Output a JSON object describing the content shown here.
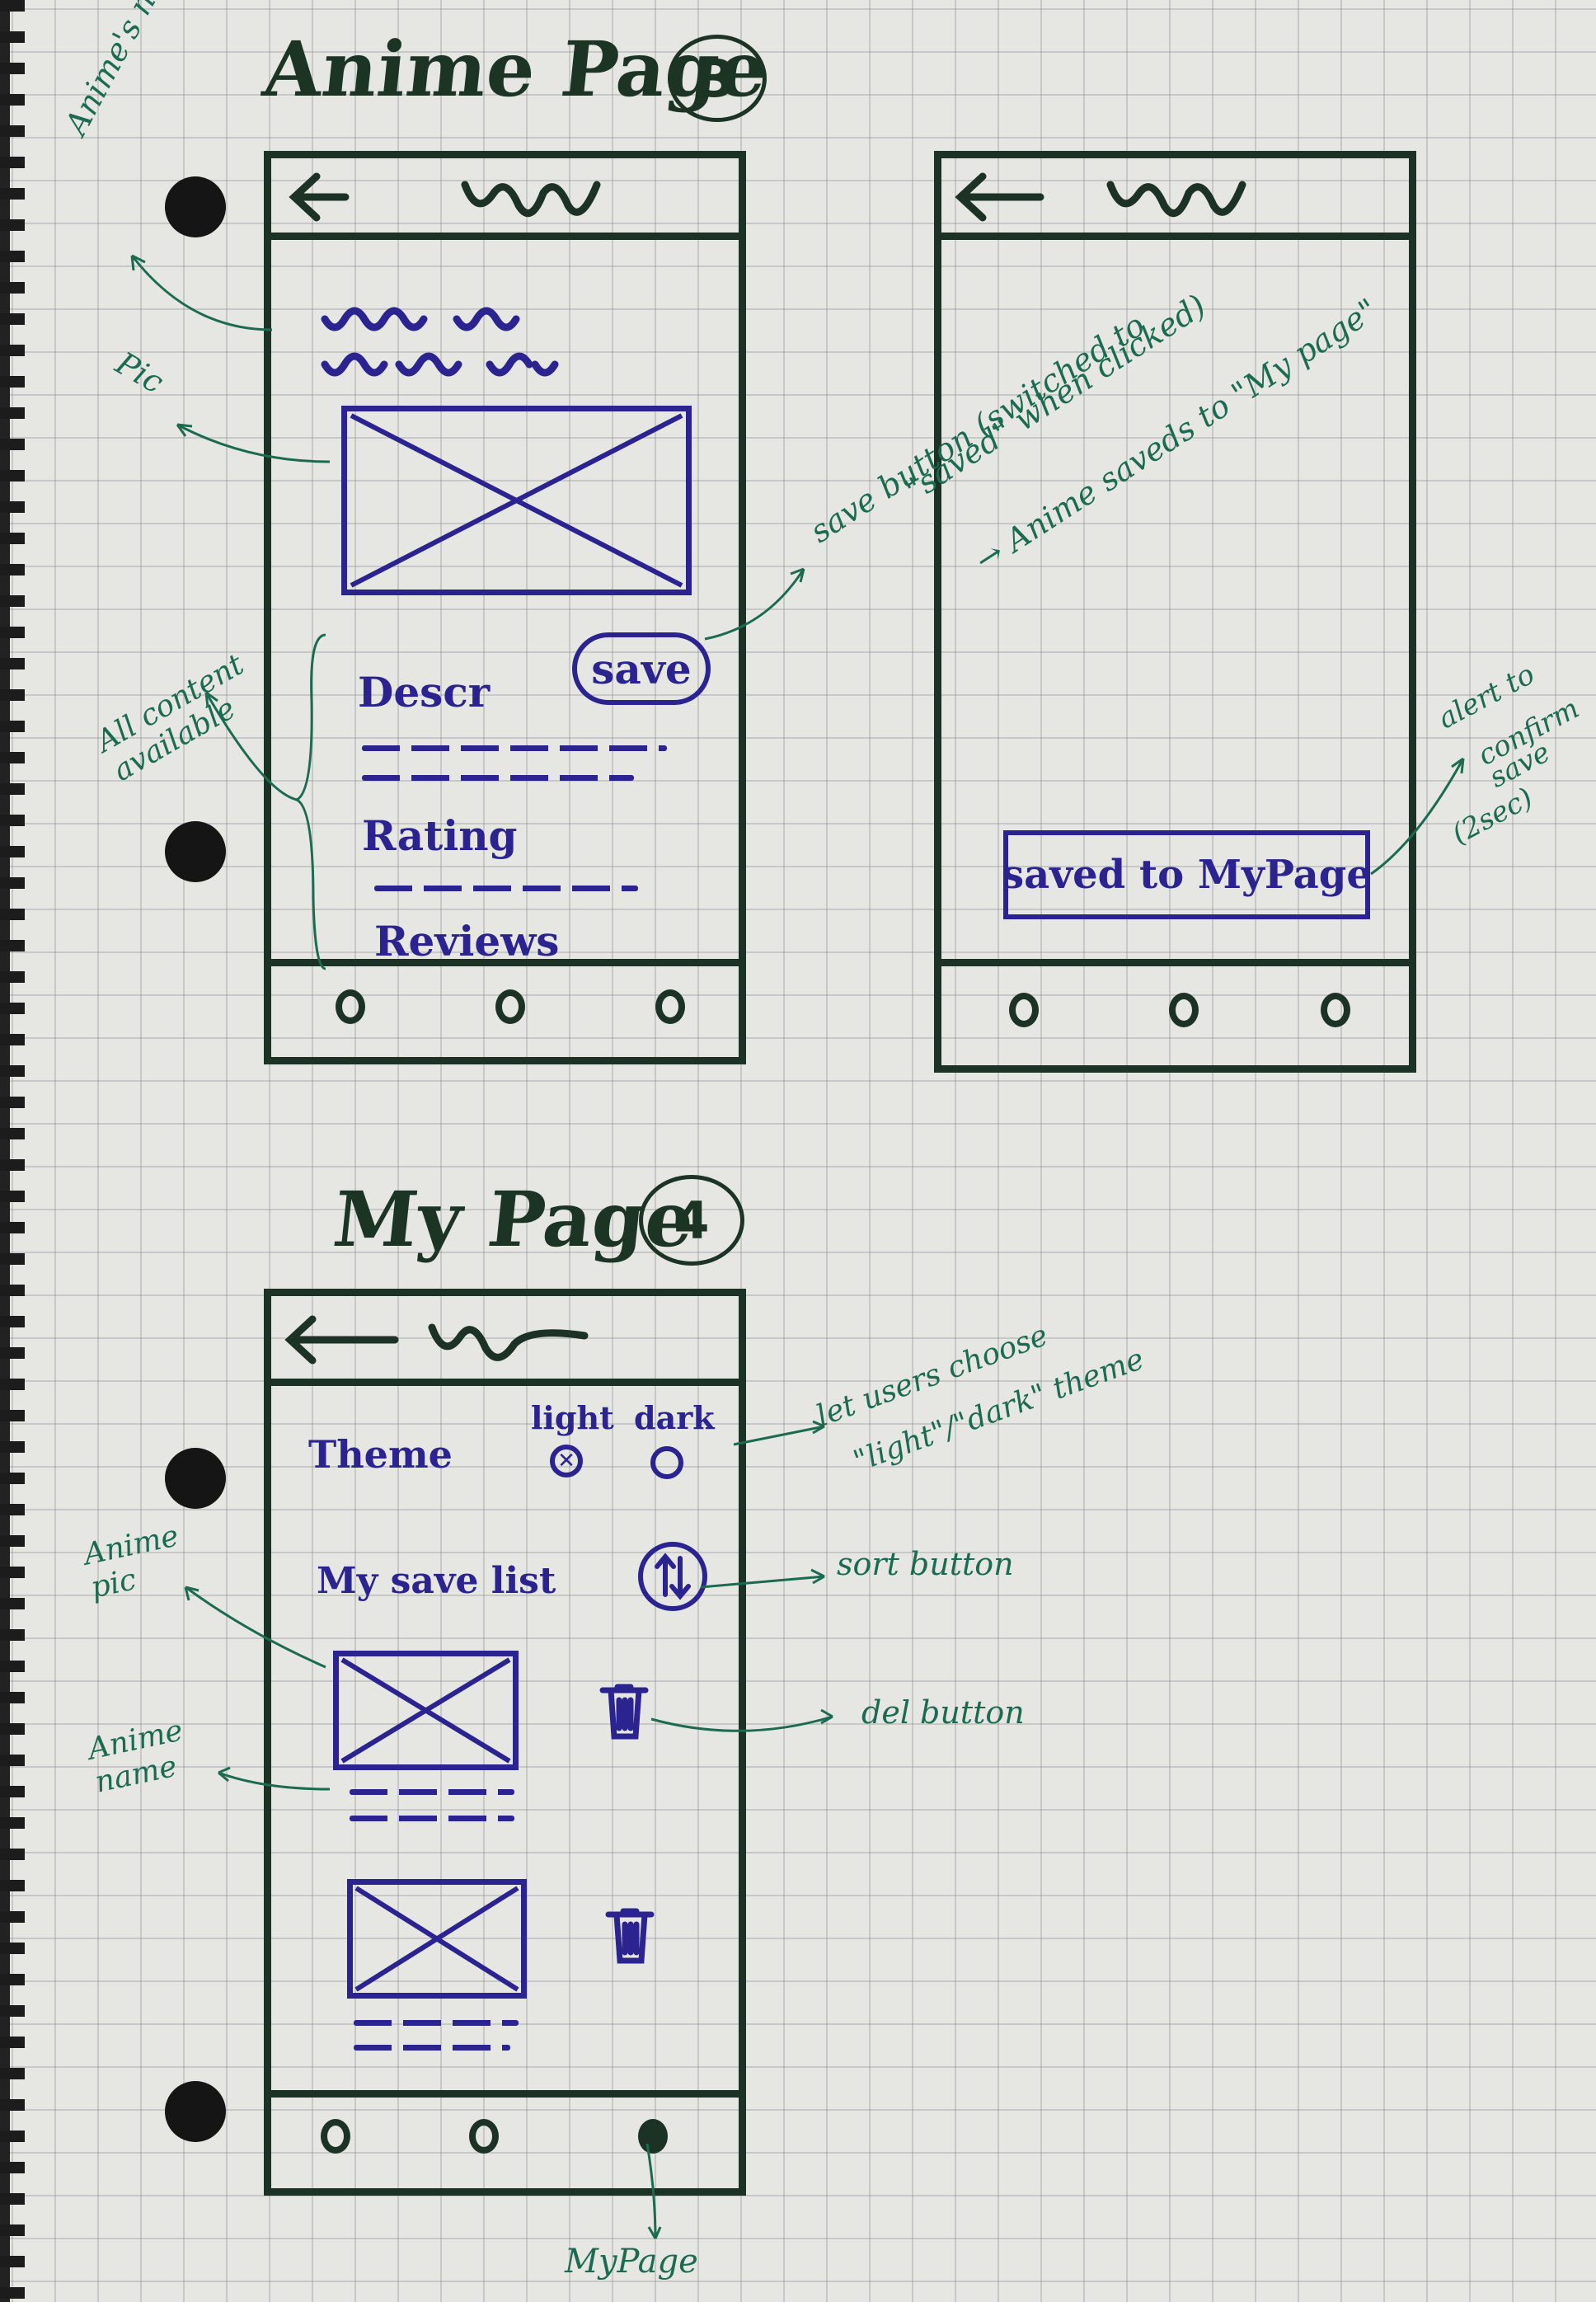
{
  "heading_anime": "Anime Page",
  "heading_anime_num": "3",
  "heading_mypage": "My Page",
  "heading_mypage_num": "4",
  "screen1": {
    "sections": [
      "Descr",
      "Rating",
      "Reviews"
    ],
    "save_label": "save"
  },
  "screen2": {
    "alert_text": "saved to MyPage"
  },
  "screen3": {
    "theme_label": "Theme",
    "light_label": "light",
    "dark_label": "dark",
    "save_list_label": "My save list"
  },
  "notes": {
    "anime_name_top": "Anime's name",
    "pic": "Pic",
    "all_content": "All content available",
    "save_button_1": "save button (switched to",
    "save_button_2": "\"saved\" when clicked)",
    "save_button_3": "→ Anime saveds to \"My page\"",
    "alert_1": "alert to",
    "alert_2": "confirm",
    "alert_3": "save",
    "alert_4": "(2sec)",
    "theme_1": "let users choose",
    "theme_2": "\"light\"/\"dark\" theme",
    "anime_pic": "Anime pic",
    "sort": "sort button",
    "del": "del button",
    "anime_name_bottom": "Anime name",
    "mypage": "MyPage"
  },
  "colors": {
    "green_ink": "#1c3224",
    "blue_ink": "#2a2390",
    "note_ink": "#1b6b52",
    "paper": "#e6e6e2"
  },
  "icons": [
    "back-arrow-icon",
    "trash-icon",
    "sort-arrows-icon",
    "nav-circle-icon"
  ]
}
